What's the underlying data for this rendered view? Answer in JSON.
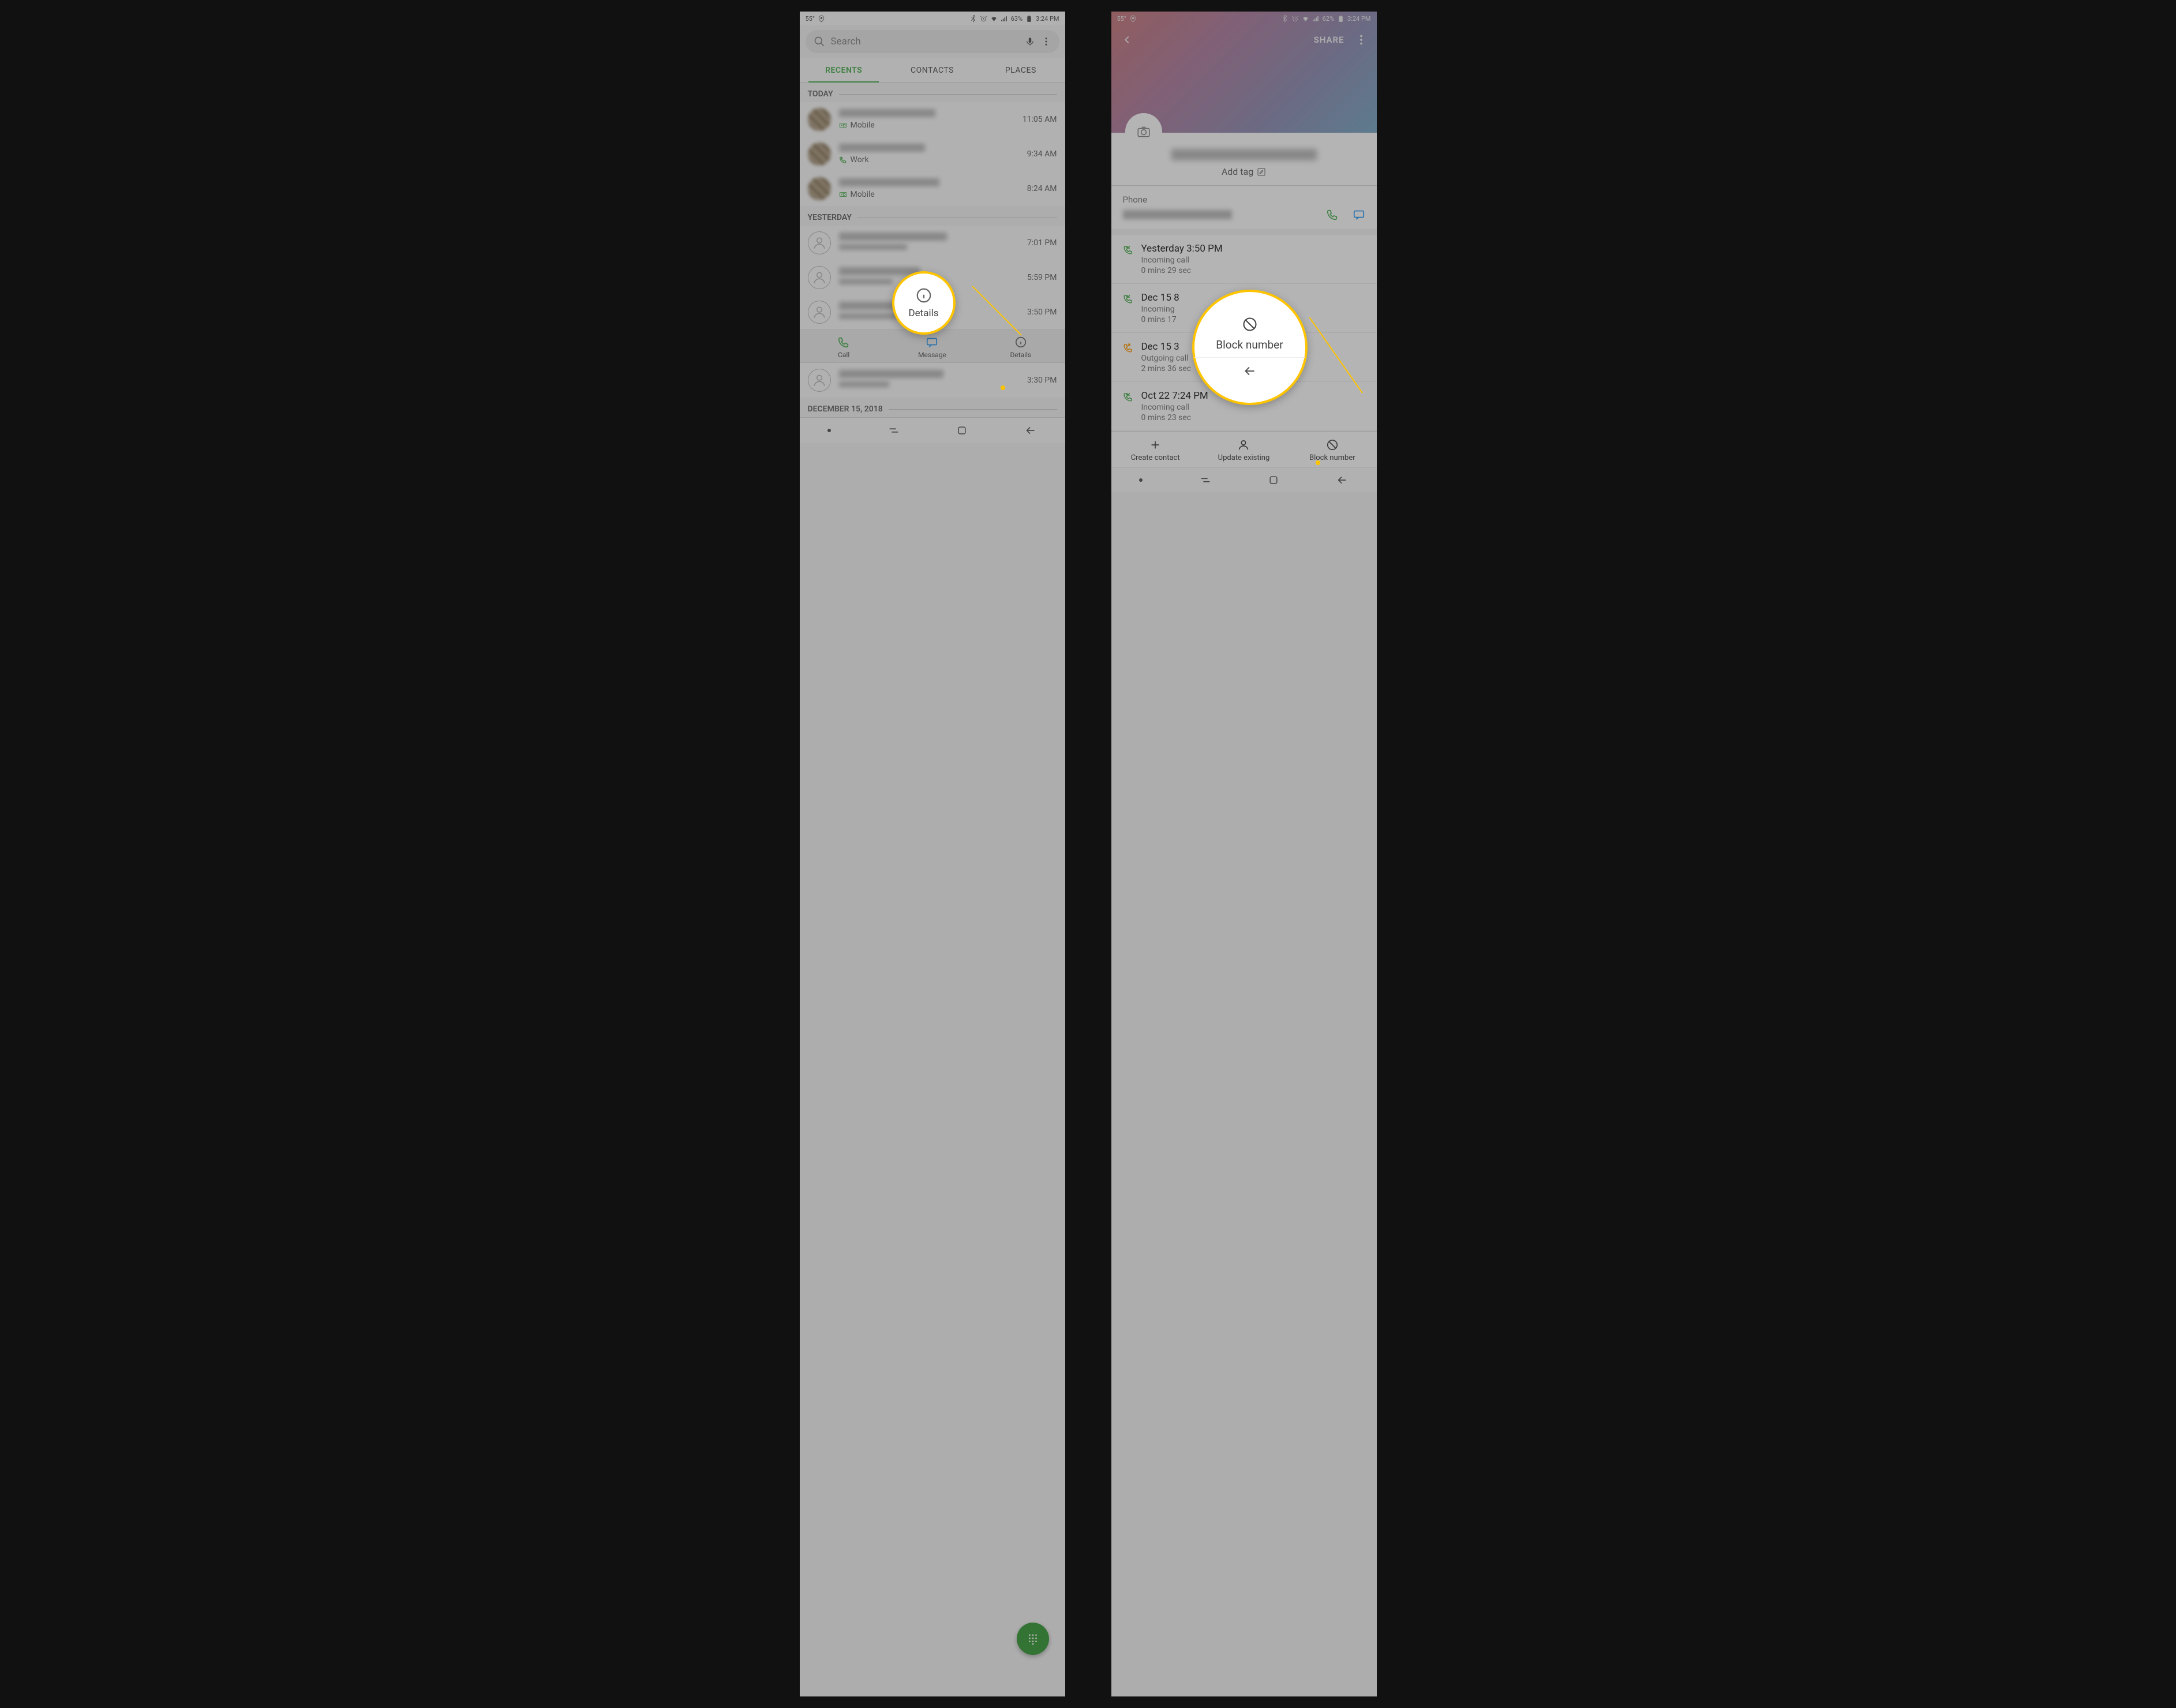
{
  "left": {
    "status": {
      "temp": "55°",
      "battery": "63%",
      "time": "3:24 PM"
    },
    "search": {
      "placeholder": "Search"
    },
    "tabs": [
      "RECENTS",
      "CONTACTS",
      "PLACES"
    ],
    "sections": {
      "today": "TODAY",
      "yesterday": "YESTERDAY",
      "dec15": "DECEMBER 15, 2018"
    },
    "rows": {
      "r1": {
        "sub": "Mobile",
        "time": "11:05 AM"
      },
      "r2": {
        "sub": "Work",
        "time": "9:34 AM"
      },
      "r3": {
        "sub": "Mobile",
        "time": "8:24 AM"
      },
      "r4": {
        "time": "7:01 PM"
      },
      "r5": {
        "time": "5:59 PM"
      },
      "r6": {
        "time": "3:50 PM"
      },
      "r7": {
        "time": "3:30 PM"
      }
    },
    "actions": {
      "call": "Call",
      "message": "Message",
      "details": "Details"
    },
    "callout": {
      "label": "Details"
    }
  },
  "right": {
    "status": {
      "temp": "55°",
      "battery": "62%",
      "time": "3:24 PM"
    },
    "topbar": {
      "share": "SHARE"
    },
    "name": {
      "addtag": "Add tag"
    },
    "phone": {
      "label": "Phone"
    },
    "history": {
      "h1": {
        "ts": "Yesterday 3:50 PM",
        "type": "Incoming call",
        "dur": "0 mins 29 sec"
      },
      "h2": {
        "ts": "Dec 15 8",
        "type": "Incoming",
        "dur": "0 mins 17"
      },
      "h3": {
        "ts": "Dec 15 3",
        "type": "Outgoing call",
        "dur": "2 mins 36 sec"
      },
      "h4": {
        "ts": "Oct 22 7:24 PM",
        "type": "Incoming call",
        "dur": "0 mins 23 sec"
      }
    },
    "bottom": {
      "create": "Create contact",
      "update": "Update existing",
      "block": "Block number"
    },
    "callout": {
      "label": "Block number"
    }
  }
}
